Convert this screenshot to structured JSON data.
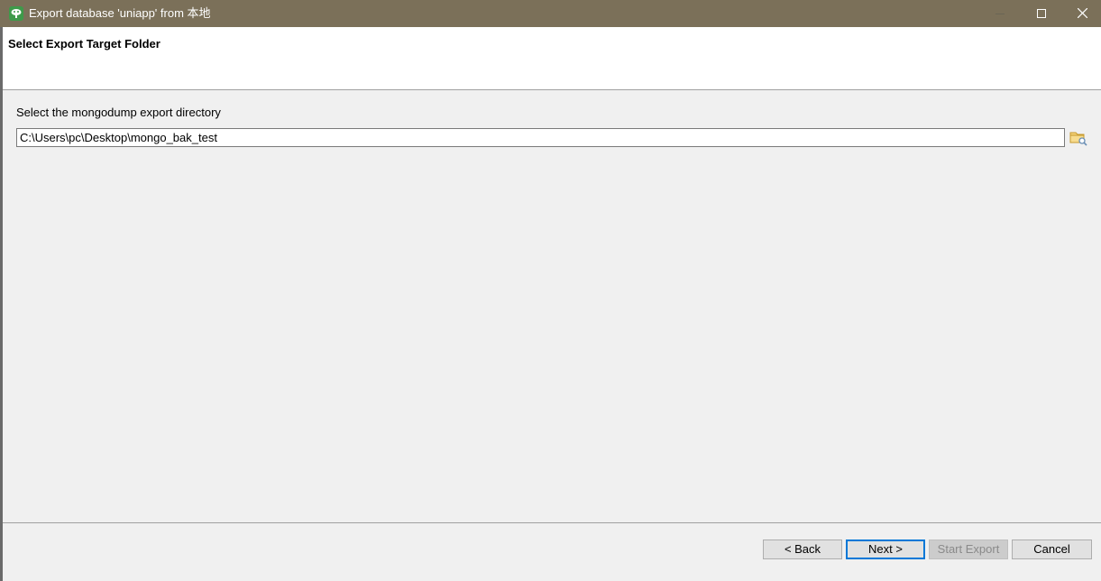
{
  "window": {
    "title": "Export database 'uniapp' from 本地",
    "app_icon": "mongo-tree-icon",
    "controls": {
      "minimize": "minimize-icon",
      "maximize": "maximize-icon",
      "close": "close-icon"
    },
    "titlebar_color": "#7b7059"
  },
  "header": {
    "title": "Select Export Target Folder"
  },
  "main": {
    "directory_label": "Select the mongodump export directory",
    "directory_value": "C:\\Users\\pc\\Desktop\\mongo_bak_test",
    "browse_icon": "folder-browse-icon"
  },
  "footer": {
    "back_label": "< Back",
    "next_label": "Next >",
    "start_export_label": "Start Export",
    "cancel_label": "Cancel"
  },
  "colors": {
    "accent": "#0078d7",
    "disabled_text": "#8a8a8a"
  }
}
